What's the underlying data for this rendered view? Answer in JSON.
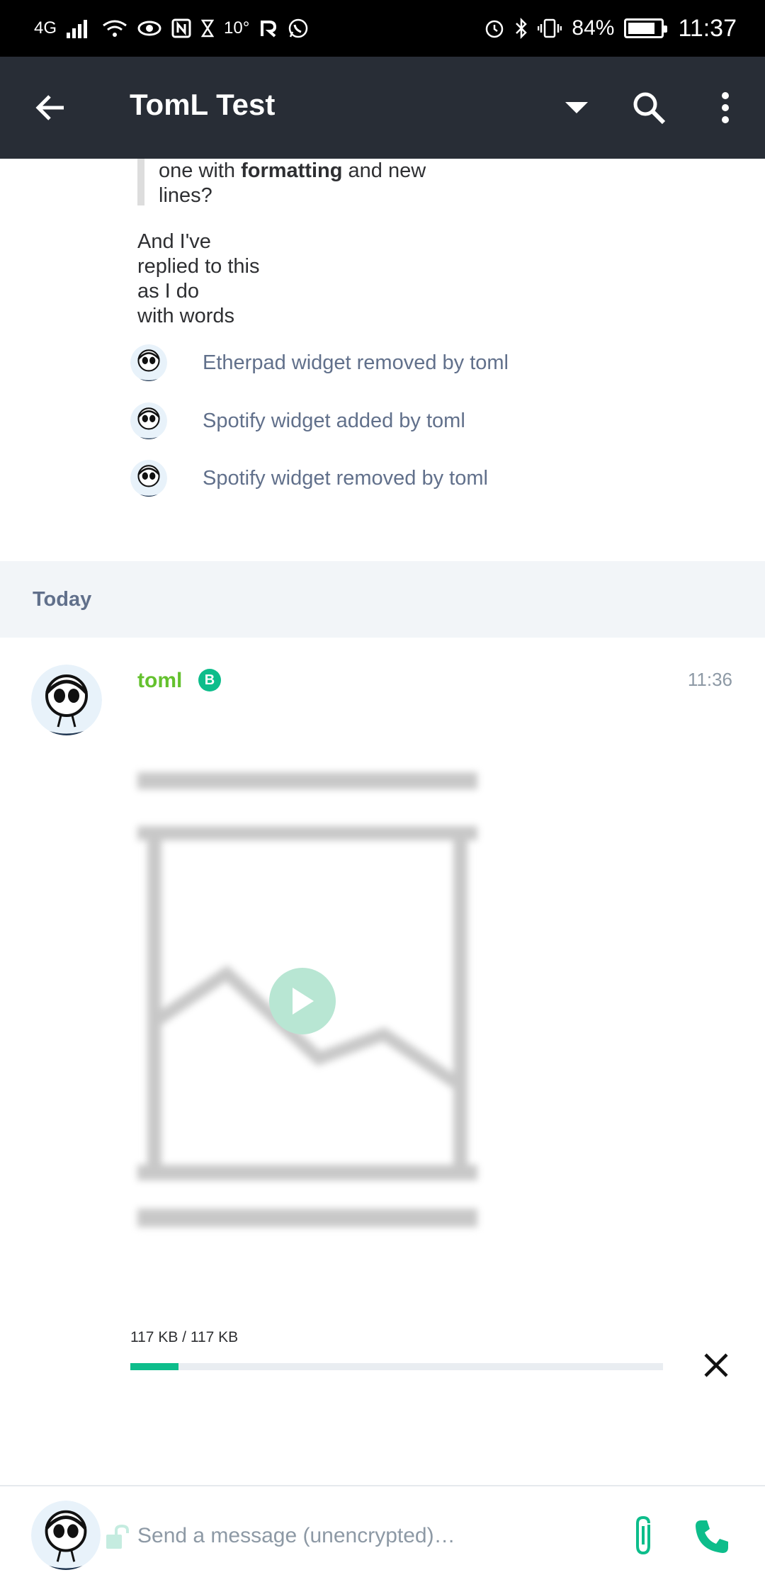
{
  "status_bar": {
    "network": "4G",
    "temperature": "10°",
    "battery": "84%",
    "time": "11:37"
  },
  "header": {
    "title": "TomL Test",
    "back_icon": "arrow-left-icon",
    "dropdown_icon": "caret-down-icon",
    "search_icon": "search-icon",
    "menu_icon": "more-vert-icon"
  },
  "timeline": {
    "quote_prefix": "one with ",
    "quote_bold": "formatting",
    "quote_suffix": " and new\nlines?",
    "reply": "And I've\nreplied to this\nas I do\nwith words",
    "events": [
      {
        "text": "Etherpad widget removed by toml"
      },
      {
        "text": "Spotify widget added by toml"
      },
      {
        "text": "Spotify widget removed by toml"
      }
    ],
    "date_separator": "Today",
    "message": {
      "sender": "toml",
      "badge": "B",
      "time": "11:36",
      "upload_progress_label": "117 KB / 117 KB",
      "upload_progress": 0.09
    }
  },
  "composer": {
    "placeholder": "Send a message (unencrypted)…"
  },
  "colors": {
    "accent": "#0dbd8b",
    "sender": "#64c12e",
    "header_bg": "#282d36",
    "event_text": "#61708b"
  }
}
